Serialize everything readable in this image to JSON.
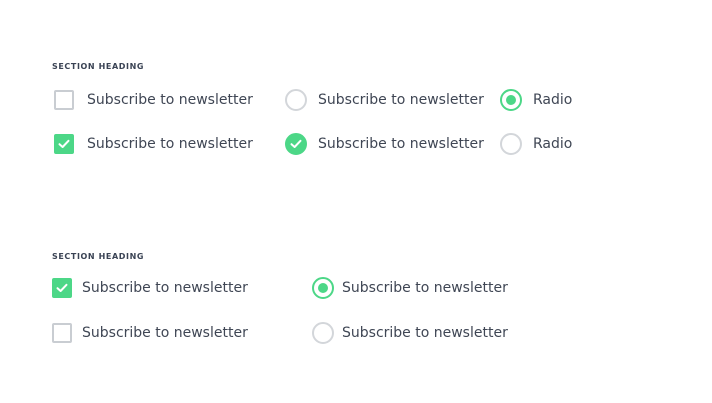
{
  "section1": {
    "heading": "SECTION HEADING",
    "row1": {
      "checkbox_label": "Subscribe to newsletter",
      "radio_round_label": "Subscribe to newsletter",
      "radio_label": "Radio"
    },
    "row2": {
      "checkbox_label": "Subscribe to newsletter",
      "radio_round_label": "Subscribe to newsletter",
      "radio_label": "Radio"
    }
  },
  "section2": {
    "heading": "SECTION HEADING",
    "row1": {
      "checkbox_label": "Subscribe to newsletter",
      "radio_label": "Subscribe to newsletter"
    },
    "row2": {
      "checkbox_label": "Subscribe to newsletter",
      "radio_label": "Subscribe to newsletter"
    }
  },
  "colors": {
    "accent": "#4cd787",
    "border": "#c9cdd2",
    "text": "#3f4654"
  }
}
